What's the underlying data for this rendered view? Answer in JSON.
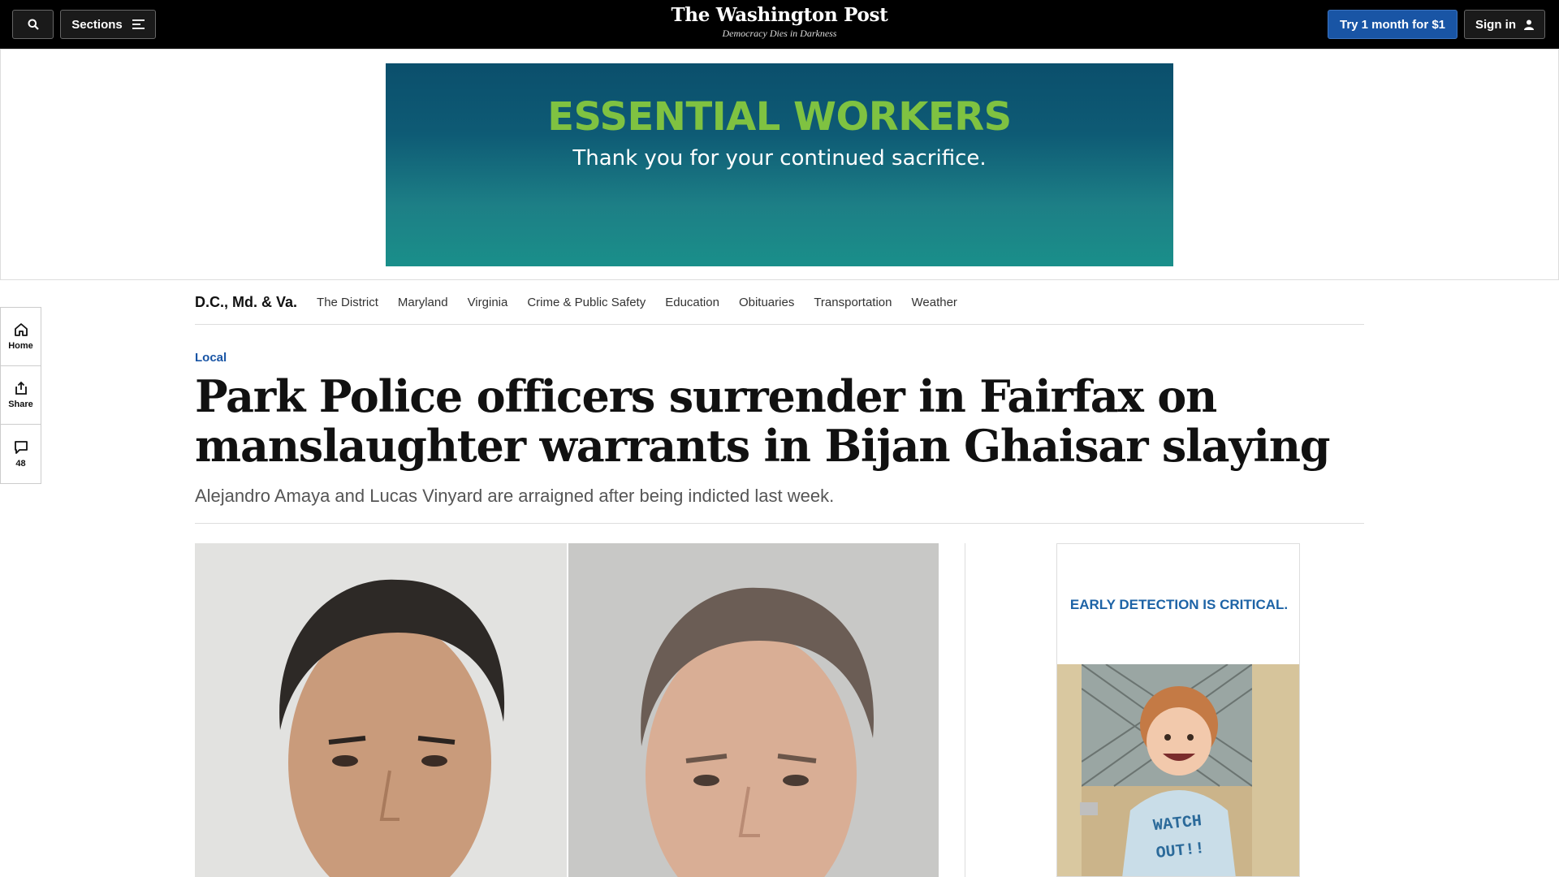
{
  "topbar": {
    "sections_label": "Sections",
    "logo": "The Washington Post",
    "tagline": "Democracy Dies in Darkness",
    "subscribe_label": "Try 1 month for $1",
    "signin_label": "Sign in"
  },
  "ad_banner": {
    "headline": "ESSENTIAL WORKERS",
    "subtext": "Thank you for your continued sacrifice."
  },
  "section_nav": {
    "main": "D.C., Md. & Va.",
    "items": [
      "The District",
      "Maryland",
      "Virginia",
      "Crime & Public Safety",
      "Education",
      "Obituaries",
      "Transportation",
      "Weather"
    ]
  },
  "rail": {
    "home_label": "Home",
    "share_label": "Share",
    "comment_count": "48"
  },
  "article": {
    "kicker": "Local",
    "headline": "Park Police officers surrender in Fairfax on manslaughter warrants in Bijan Ghaisar slaying",
    "subhead": "Alejandro Amaya and Lucas Vinyard are arraigned after being indicted last week."
  },
  "side_ad": {
    "text": "EARLY DETECTION IS CRITICAL.",
    "shirt_text": "WATCH OUT!!"
  },
  "colors": {
    "accent_blue": "#1955a5",
    "ad_green": "#7fc241",
    "ad_teal": "#0e5b75"
  }
}
